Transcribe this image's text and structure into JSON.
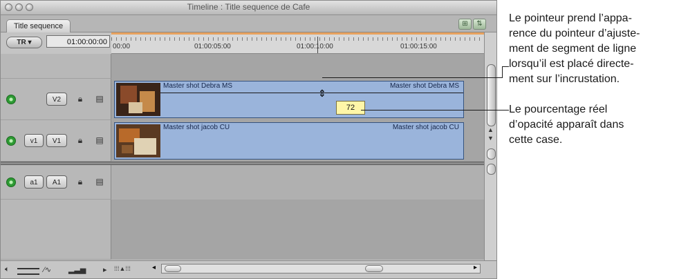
{
  "window": {
    "title": "Timeline : Title sequence de Cafe",
    "tab_label": "Title sequence"
  },
  "controls": {
    "track_selector": "TR ▾",
    "timecode": "01:00:00:00"
  },
  "ruler": {
    "labels": [
      "00:00",
      "01:00:05:00",
      "01:00:10:00",
      "01:00:15:00"
    ]
  },
  "tracks": {
    "v2": {
      "target": "V2",
      "clip_name_left": "Master shot Debra MS",
      "clip_name_right": "Master shot Debra MS"
    },
    "v1": {
      "source": "v1",
      "target": "V1",
      "clip_name_left": "Master shot jacob CU",
      "clip_name_right": "Master shot jacob CU"
    },
    "a1": {
      "source": "a1",
      "target": "A1"
    }
  },
  "opacity_tooltip": "72",
  "annotations": {
    "pointer": [
      "Le pointeur prend l’appa-",
      "rence du pointeur d’ajuste-",
      "ment de segment de ligne",
      "lorsqu’il est placé directe-",
      "ment sur l’incrustation."
    ],
    "percentage": [
      "Le pourcentage réel",
      "d’opacité apparaît dans",
      "cette case."
    ]
  },
  "colors": {
    "clip_blue": "#9ab4db",
    "visibility_green": "#2d9a33",
    "tooltip_yellow": "#fff6a8",
    "ruler_orange": "#e8a25e"
  },
  "icons": [
    "close-icon",
    "minimize-icon",
    "zoom-icon",
    "visibility-icon",
    "lock-icon",
    "auto-select-icon",
    "line-adjust-cursor-icon",
    "speaker-icon",
    "clip-overlays-icon",
    "track-height-icon"
  ]
}
